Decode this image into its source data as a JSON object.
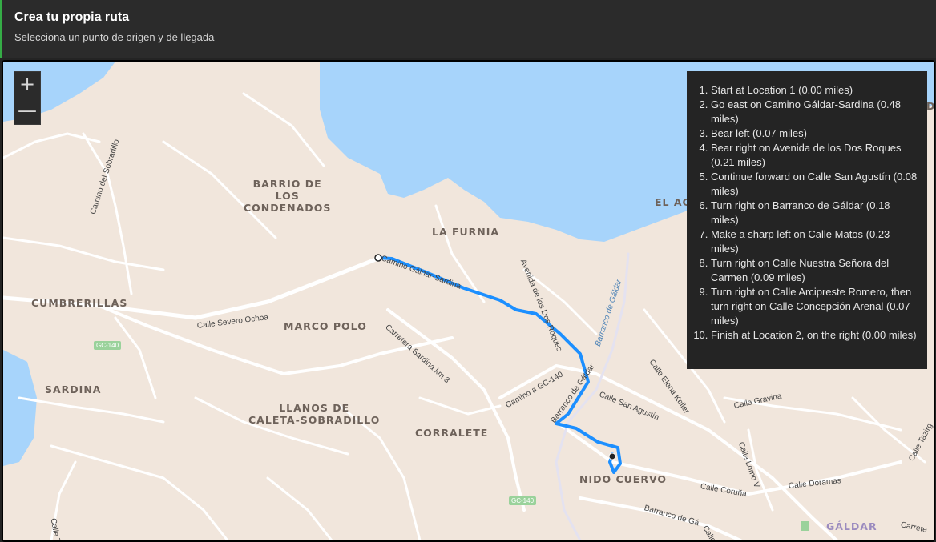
{
  "header": {
    "title": "Crea tu propia ruta",
    "subtitle": "Selecciona un punto de origen y de llegada"
  },
  "zoom": {
    "in_label": "+",
    "out_label": "—"
  },
  "directions": [
    "Start at Location 1 (0.00 miles)",
    "Go east on Camino Gáldar-Sardina (0.48 miles)",
    "Bear left (0.07 miles)",
    "Bear right on Avenida de los Dos Roques (0.21 miles)",
    "Continue forward on Calle San Agustín (0.08 miles)",
    "Turn right on Barranco de Gáldar (0.18 miles)",
    "Make a sharp left on Calle Matos (0.23 miles)",
    "Turn right on Calle Nuestra Señora del Carmen (0.09 miles)",
    "Turn right on Calle Arcipreste Romero, then turn right on Calle Concepción Arenal (0.07 miles)",
    "Finish at Location 2, on the right (0.00 miles)"
  ],
  "map": {
    "colors": {
      "land": "#f1e6dc",
      "water": "#a7d4fb",
      "road": "#ffffff",
      "route": "#1c8fff",
      "green": "#9ad29b"
    },
    "places": {
      "barrio": "BARRIO DE\nLOS\nCONDENADOS",
      "furnia": "LA FURNIA",
      "cumbrerillas": "CUMBRERILLAS",
      "marco_polo": "MARCO POLO",
      "sardina": "SARDINA",
      "llanos": "LLANOS DE\nCALETA-SOBRADILLO",
      "corralete": "CORRALETE",
      "nido": "NIDO CUERVO",
      "galdar": "GÁLDAR",
      "el_ag": "EL AG",
      "de": "DE"
    },
    "streets": {
      "sobradillo": "Camino del Sobradillo",
      "severo": "Calle Severo Ochoa",
      "sardina_km": "Carretera Sardina km 3",
      "camino_gc": "Camino a GC-140",
      "gs_road": "Camino Gáldar-Sardina",
      "avenida": "Avenida de los Dos Roques",
      "barr_galdar": "Barranco de Gáldar",
      "san_agustin": "Calle San Agustín",
      "elena": "Calle Elena Keller",
      "gravina": "Calle Gravina",
      "lomo": "Calle Lomo V",
      "coruna": "Calle Coruña",
      "doramas": "Calle Doramas",
      "barranco_ga": "Barranco de Gá",
      "calle_ti": "Calle Ti",
      "calle_ta": "Calle Tazirg",
      "carretera": "Carrete",
      "calle_m": "Calle"
    },
    "water_label": "Barranco de Gáldar",
    "shields": [
      "GC-140",
      "GC-140"
    ]
  }
}
